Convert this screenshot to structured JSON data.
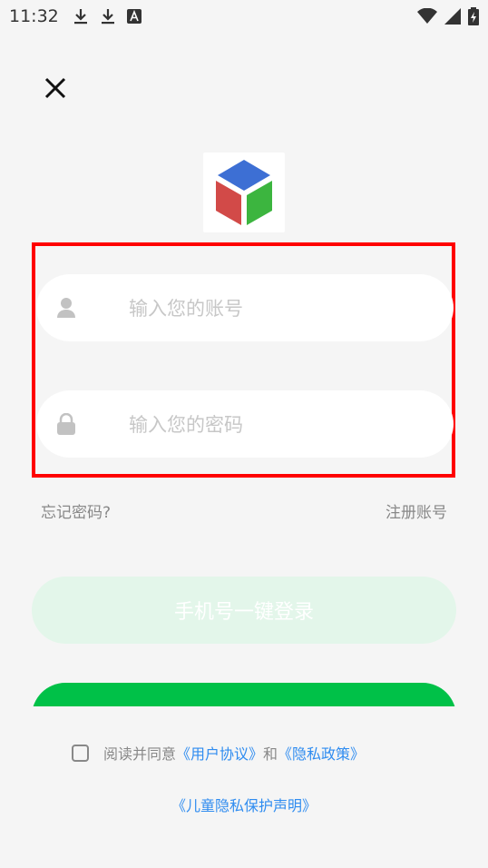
{
  "status_bar": {
    "time": "11:32",
    "left_icons": [
      "download-icon",
      "download-icon",
      "text-a-icon"
    ],
    "right_icons": [
      "wifi-icon",
      "signal-icon",
      "battery-icon"
    ]
  },
  "close_icon": "close-icon",
  "logo": "cube-logo",
  "account_field": {
    "placeholder": "输入您的账号",
    "value": "",
    "icon": "user-icon"
  },
  "password_field": {
    "placeholder": "输入您的密码",
    "value": "",
    "icon": "lock-icon"
  },
  "links": {
    "forgot": "忘记密码?",
    "register": "注册账号"
  },
  "buttons": {
    "phone_login": "手机号一键登录"
  },
  "agreement": {
    "prefix": "阅读并同意 ",
    "user_agreement": "《用户协议》",
    "and": "和",
    "privacy_policy": "《隐私政策》",
    "child_privacy": "《儿童隐私保护声明》"
  },
  "colors": {
    "accent": "#00c148",
    "accent_light": "#e3f6ea",
    "link": "#2f8cf0",
    "highlight": "#ff0000"
  }
}
